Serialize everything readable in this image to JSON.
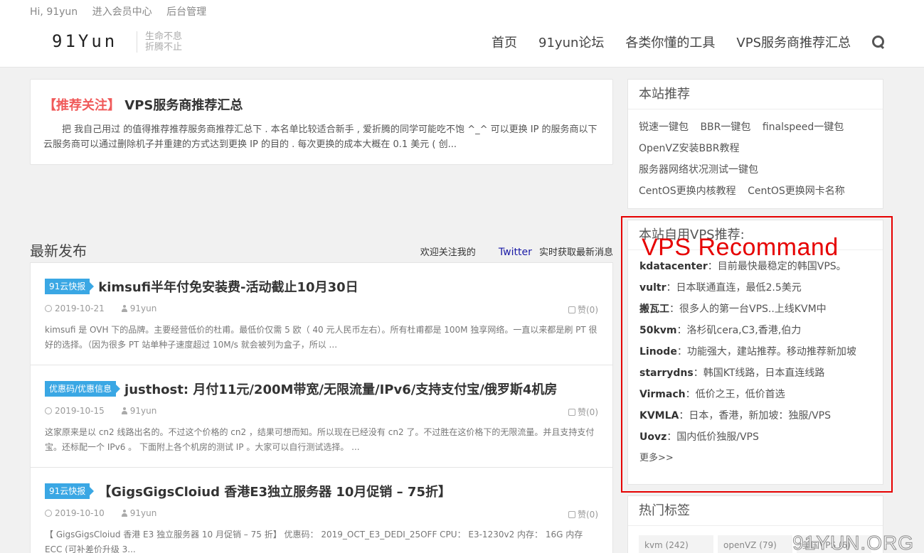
{
  "topbar": {
    "greeting": "Hi, 91yun",
    "member_center": "进入会员中心",
    "admin": "后台管理"
  },
  "logo": {
    "text": "91Yun",
    "slogan_line1": "生命不息",
    "slogan_line2": "折腾不止"
  },
  "nav": {
    "items": [
      "首页",
      "91yun论坛",
      "各类你懂的工具",
      "VPS服务商推荐汇总"
    ]
  },
  "featured": {
    "tag": "【推荐关注】",
    "title": "VPS服务商推荐汇总",
    "desc": "把 我自己用过 的值得推荐推荐服务商推荐汇总下 . 本名单比较适合新手 , 爱折腾的同学可能吃不饱 ^_^ 可以更换 IP 的服务商以下云服务商可以通过删除机子并重建的方式达到更换 IP 的目的 . 每次更换的成本大概在 0.1 美元 ( 创..."
  },
  "latest": {
    "title": "最新发布",
    "follow_prefix": "欢迎关注我的",
    "twitter": "Twitter",
    "follow_suffix": "实时获取最新消息"
  },
  "posts": [
    {
      "category": "91云快报",
      "title": "kimsufi半年付免安装费-活动截止10月30日",
      "date": "2019-10-21",
      "author": "91yun",
      "likes": "赞(0)",
      "desc": "kimsufi 是 OVH 下的品牌。主要经营低价的杜甫。最低价仅需 5 欧（ 40 元人民币左右）。所有杜甫都是 100M 独享网络。一直以来都是刷 PT 很好的选择。（因为很多 PT 站单种子速度超过 10M/s 就会被列为盒子，所以 ..."
    },
    {
      "category": "优惠码/优惠信息",
      "title": "justhost: 月付11元/200M带宽/无限流量/IPv6/支持支付宝/俄罗斯4机房",
      "date": "2019-10-15",
      "author": "91yun",
      "likes": "赞(0)",
      "desc": "这家原来是以 cn2 线路出名的。不过这个价格的 cn2 ，结果可想而知。所以现在已经没有 cn2 了。不过胜在这价格下的无限流量。并且支持支付宝。还标配一个 IPv6 。 下面附上各个机房的测试 IP 。大家可以自行测试选择。   ..."
    },
    {
      "category": "91云快报",
      "title": "【GigsGigsCloiud 香港E3独立服务器 10月促销 – 75折】",
      "date": "2019-10-10",
      "author": "91yun",
      "likes": "赞(0)",
      "desc": "【 GigsGigsCloiud 香港 E3 独立服务器 10 月促销 – 75 折】 优惠码： 2019_OCT_E3_DEDI_25OFF CPU： E3-1230v2 内存： 16G 内存 ECC (可补差价升级 3..."
    }
  ],
  "sidebar": {
    "recommend_title": "本站推荐",
    "recommend_rows": [
      [
        "锐速一键包",
        "BBR一键包",
        "finalspeed一键包"
      ],
      [
        "OpenVZ安装BBR教程"
      ],
      [
        "服务器网络状况测试一键包"
      ],
      [
        "CentOS更换内核教程",
        "CentOS更换网卡名称"
      ]
    ],
    "vps_title": "本站自用VPS推荐:",
    "vps_overlay": "VPS Recommand",
    "vps_items": [
      {
        "name": "kdatacenter",
        "desc": "：目前最快最稳定的韩国VPS。"
      },
      {
        "name": "vultr",
        "desc": "：日本联通直连，最低2.5美元"
      },
      {
        "name": "搬瓦工",
        "desc": "：很多人的第一台VPS..上线KVM中"
      },
      {
        "name": "50kvm",
        "desc": "：洛杉矶cera,C3,香港,伯力"
      },
      {
        "name": "Linode",
        "desc": "：功能强大，建站推荐。移动推荐新加坡"
      },
      {
        "name": "starrydns",
        "desc": "：韩国KT线路，日本直连线路"
      },
      {
        "name": "Virmach",
        "desc": "：低价之王，低价首选"
      },
      {
        "name": "KVMLA",
        "desc": "：日本，香港，新加坡：独服/VPS"
      },
      {
        "name": "Uovz",
        "desc": "：国内低价独服/VPS"
      }
    ],
    "vps_more": "更多>>",
    "tags_title": "热门标签",
    "tags": [
      "kvm (242)",
      "openVZ (79)",
      "美国VPS (6)"
    ]
  },
  "watermark": "91YUN.ORG"
}
